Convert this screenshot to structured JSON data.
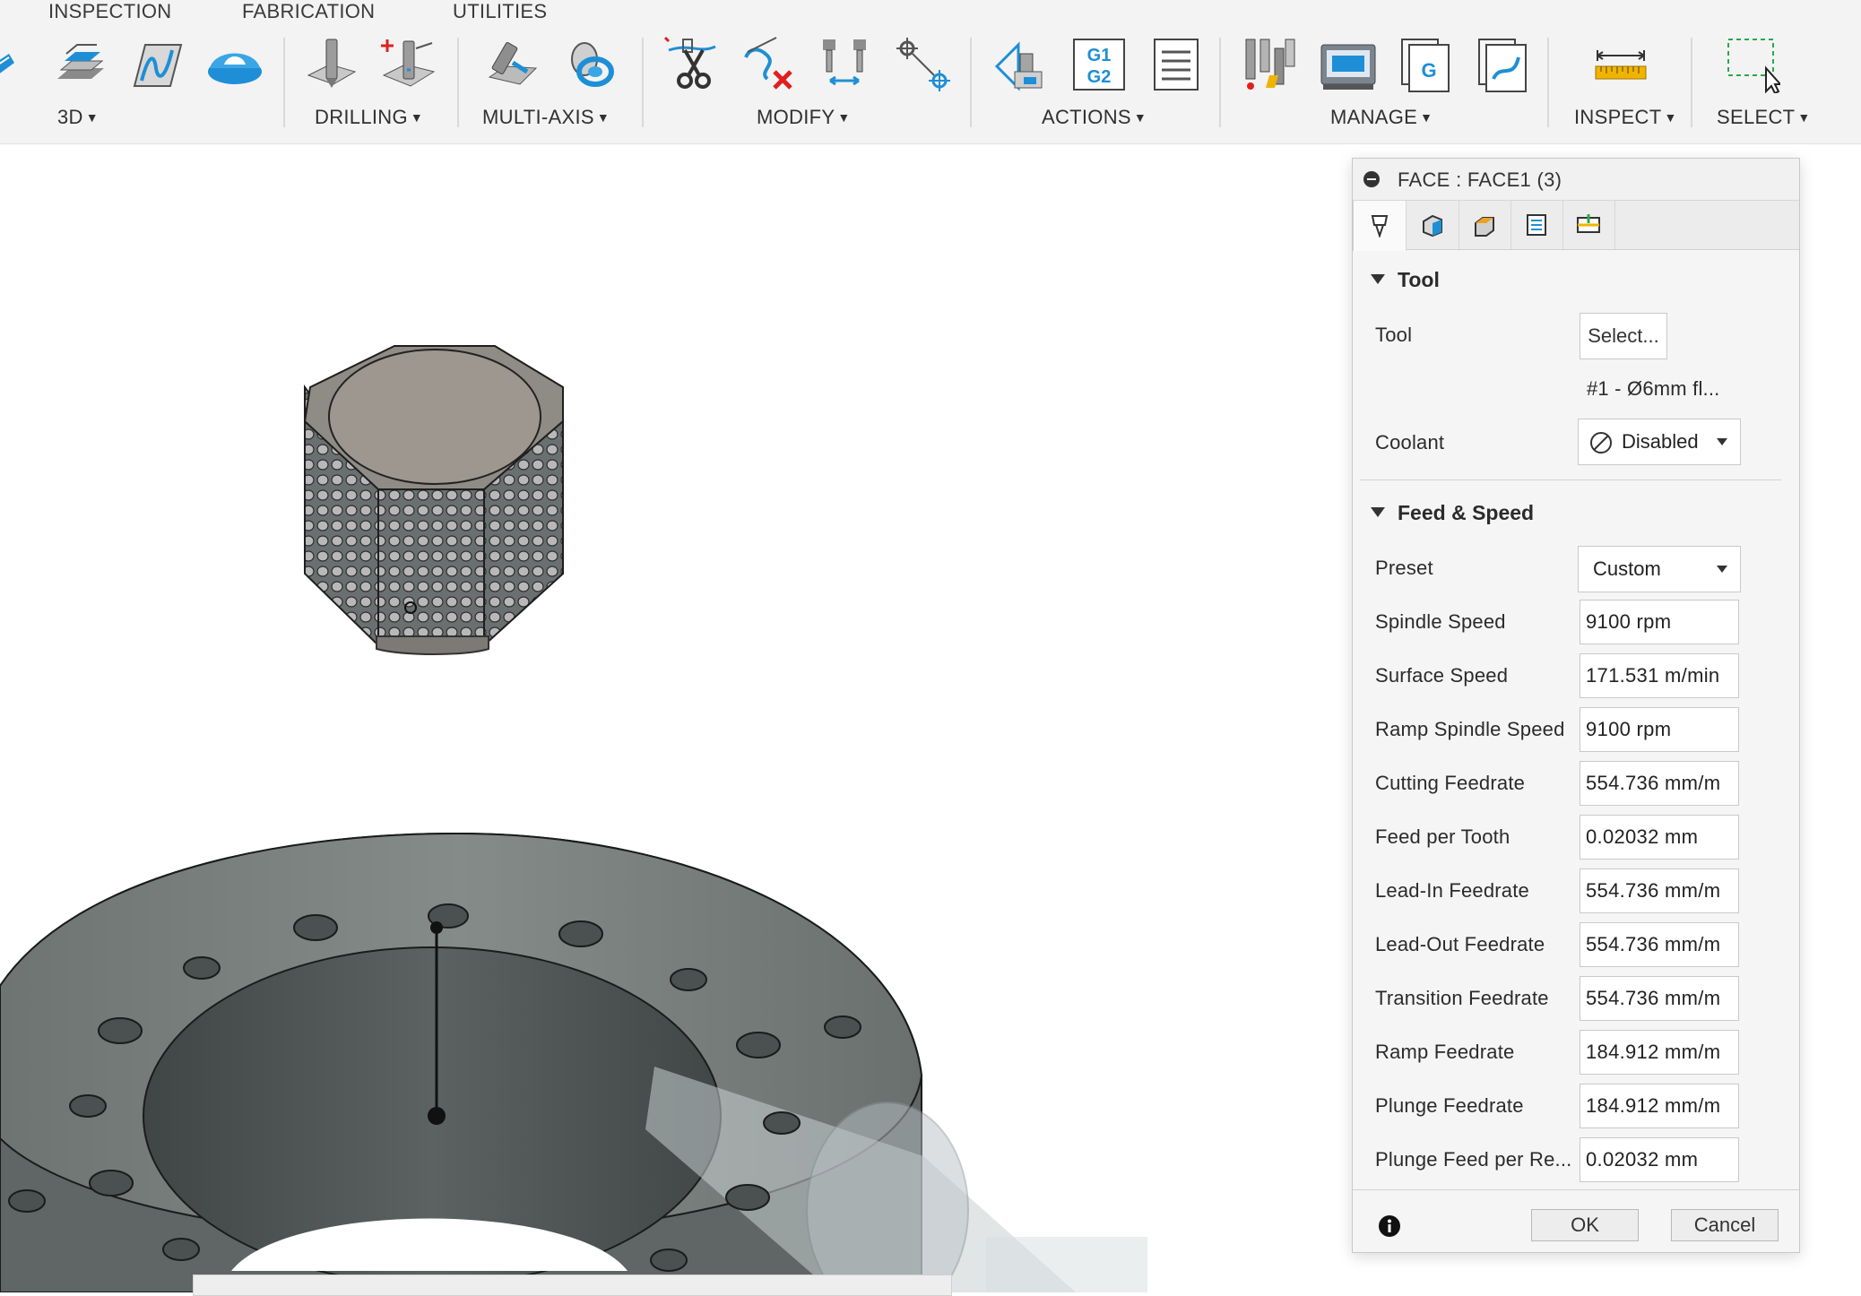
{
  "toolbar": {
    "tabs": [
      "INSPECTION",
      "FABRICATION",
      "UTILITIES"
    ],
    "groups": {
      "g3d": "3D",
      "drilling": "DRILLING",
      "multiaxis": "MULTI-AXIS",
      "modify": "MODIFY",
      "actions": "ACTIONS",
      "manage": "MANAGE",
      "inspect": "INSPECT",
      "select": "SELECT"
    },
    "actions_icon_text": [
      "G1",
      "G2"
    ],
    "manage_icon_letter": "G"
  },
  "dialog": {
    "title": "FACE : FACE1 (3)",
    "tabs": [
      "tool-tab-icon",
      "geometry-tab-icon",
      "heights-tab-icon",
      "passes-tab-icon",
      "linking-tab-icon"
    ],
    "tool_section": {
      "heading": "Tool",
      "tool_label": "Tool",
      "select_button": "Select...",
      "tool_name": "#1 - Ø6mm fl...",
      "coolant_label": "Coolant",
      "coolant_value": "Disabled"
    },
    "feed_section": {
      "heading": "Feed & Speed",
      "preset_label": "Preset",
      "preset_value": "Custom",
      "rows": [
        {
          "label": "Spindle Speed",
          "value": "9100 rpm"
        },
        {
          "label": "Surface Speed",
          "value": "171.531 m/min"
        },
        {
          "label": "Ramp Spindle Speed",
          "value": "9100 rpm"
        },
        {
          "label": "Cutting Feedrate",
          "value": "554.736 mm/m"
        },
        {
          "label": "Feed per Tooth",
          "value": "0.02032 mm"
        },
        {
          "label": "Lead-In Feedrate",
          "value": "554.736 mm/m"
        },
        {
          "label": "Lead-Out Feedrate",
          "value": "554.736 mm/m"
        },
        {
          "label": "Transition Feedrate",
          "value": "554.736 mm/m"
        },
        {
          "label": "Ramp Feedrate",
          "value": "184.912 mm/m"
        },
        {
          "label": "Plunge Feedrate",
          "value": "184.912 mm/m"
        },
        {
          "label": "Plunge Feed per Re...",
          "value": "0.02032 mm"
        }
      ]
    },
    "footer": {
      "ok": "OK",
      "cancel": "Cancel"
    }
  },
  "colors": {
    "toolbar_bg": "#f3f3f3",
    "accent_blue": "#1e8fd6",
    "model_dark": "#5f6565",
    "model_top": "#9a958e"
  }
}
